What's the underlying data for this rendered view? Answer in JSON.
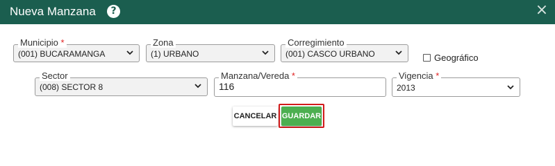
{
  "dialog": {
    "title": "Nueva Manzana",
    "help_icon": "?",
    "close_icon": "×",
    "colors": {
      "header_bg": "#1b5e4f",
      "required": "#e02020",
      "save_bg": "#4caf50",
      "highlight": "#d11a1a"
    }
  },
  "form": {
    "municipio": {
      "label": "Municipio",
      "required_mark": "*",
      "value": "(001) BUCARAMANGA"
    },
    "zona": {
      "label": "Zona",
      "required_mark": "",
      "value": "(1) URBANO"
    },
    "corregimiento": {
      "label": "Corregimiento",
      "required_mark": "",
      "value": "(001) CASCO URBANO"
    },
    "geografico": {
      "label": "Geográfico",
      "checked": false
    },
    "sector": {
      "label": "Sector",
      "required_mark": "",
      "value": "(008) SECTOR 8"
    },
    "manzana": {
      "label": "Manzana/Vereda",
      "required_mark": "*",
      "value": "116"
    },
    "vigencia": {
      "label": "Vigencia",
      "required_mark": "*",
      "value": "2013"
    }
  },
  "actions": {
    "cancel_label": "CANCELAR",
    "save_label": "GUARDAR"
  }
}
